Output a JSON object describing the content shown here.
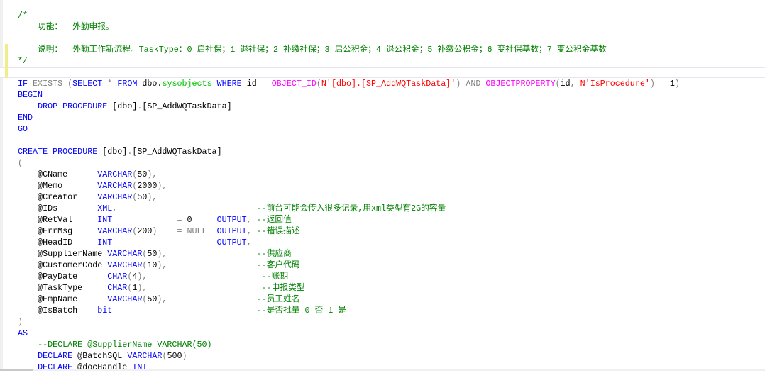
{
  "colors": {
    "keyword": "#0000ff",
    "comment": "#008000",
    "string": "#ff0000",
    "function": "#ff00ff",
    "operator": "#808080",
    "system": "#00c000"
  },
  "code": {
    "lines": [
      {
        "tokens": [
          [
            "cmt",
            "/*"
          ]
        ]
      },
      {
        "tokens": [
          [
            "cmt",
            "    功能：  外勤申报。"
          ]
        ]
      },
      {
        "tokens": []
      },
      {
        "mark": true,
        "tokens": [
          [
            "cmt",
            "    说明：  外勤工作新流程。TaskType：0=启社保；1=退社保；2=补缴社保；3=启公积金；4=退公积金；5=补缴公积金；6=变社保基数；7=变公积金基数"
          ]
        ]
      },
      {
        "mark": true,
        "tokens": [
          [
            "cmt",
            "*/"
          ]
        ]
      },
      {
        "mark": true,
        "cursor": true,
        "tokens": []
      },
      {
        "tokens": [
          [
            "kw",
            "IF"
          ],
          [
            "pl",
            " "
          ],
          [
            "gray",
            "EXISTS"
          ],
          [
            "pl",
            " "
          ],
          [
            "gray",
            "("
          ],
          [
            "kw",
            "SELECT"
          ],
          [
            "pl",
            " "
          ],
          [
            "gray",
            "*"
          ],
          [
            "pl",
            " "
          ],
          [
            "kw",
            "FROM"
          ],
          [
            "pl",
            " dbo."
          ],
          [
            "sys",
            "sysobjects"
          ],
          [
            "pl",
            " "
          ],
          [
            "kw",
            "WHERE"
          ],
          [
            "pl",
            " id "
          ],
          [
            "gray",
            "="
          ],
          [
            "pl",
            " "
          ],
          [
            "fn",
            "OBJECT_ID"
          ],
          [
            "gray",
            "("
          ],
          [
            "str",
            "N'[dbo].[SP_AddWQTaskData]'"
          ],
          [
            "gray",
            ")"
          ],
          [
            "pl",
            " "
          ],
          [
            "gray",
            "AND"
          ],
          [
            "pl",
            " "
          ],
          [
            "fn",
            "OBJECTPROPERTY"
          ],
          [
            "gray",
            "("
          ],
          [
            "pl",
            "id"
          ],
          [
            "gray",
            ","
          ],
          [
            "pl",
            " "
          ],
          [
            "str",
            "N'IsProcedure'"
          ],
          [
            "gray",
            ")"
          ],
          [
            "pl",
            " "
          ],
          [
            "gray",
            "="
          ],
          [
            "pl",
            " 1"
          ],
          [
            "gray",
            ")"
          ]
        ]
      },
      {
        "tokens": [
          [
            "kw",
            "BEGIN"
          ]
        ]
      },
      {
        "tokens": [
          [
            "pl",
            "    "
          ],
          [
            "kw",
            "DROP"
          ],
          [
            "pl",
            " "
          ],
          [
            "kw",
            "PROCEDURE"
          ],
          [
            "pl",
            " [dbo]"
          ],
          [
            "gray",
            "."
          ],
          [
            "pl",
            "[SP_AddWQTaskData]"
          ]
        ]
      },
      {
        "tokens": [
          [
            "kw",
            "END"
          ]
        ]
      },
      {
        "tokens": [
          [
            "kw",
            "GO"
          ]
        ]
      },
      {
        "tokens": []
      },
      {
        "tokens": [
          [
            "kw",
            "CREATE"
          ],
          [
            "pl",
            " "
          ],
          [
            "kw",
            "PROCEDURE"
          ],
          [
            "pl",
            " [dbo]"
          ],
          [
            "gray",
            "."
          ],
          [
            "pl",
            "[SP_AddWQTaskData]"
          ]
        ]
      },
      {
        "tokens": [
          [
            "gray",
            "("
          ]
        ]
      },
      {
        "tokens": [
          [
            "pl",
            "    @CName      "
          ],
          [
            "kw",
            "VARCHAR"
          ],
          [
            "gray",
            "("
          ],
          [
            "pl",
            "50"
          ],
          [
            "gray",
            "),"
          ]
        ]
      },
      {
        "tokens": [
          [
            "pl",
            "    @Memo       "
          ],
          [
            "kw",
            "VARCHAR"
          ],
          [
            "gray",
            "("
          ],
          [
            "pl",
            "2000"
          ],
          [
            "gray",
            "),"
          ]
        ]
      },
      {
        "tokens": [
          [
            "pl",
            "    @Creator    "
          ],
          [
            "kw",
            "VARCHAR"
          ],
          [
            "gray",
            "("
          ],
          [
            "pl",
            "50"
          ],
          [
            "gray",
            "),"
          ]
        ]
      },
      {
        "tokens": [
          [
            "pl",
            "    @IDs        "
          ],
          [
            "kw",
            "XML"
          ],
          [
            "gray",
            ","
          ],
          [
            "pl",
            "                            "
          ],
          [
            "cmt",
            "--前台可能会传入很多记录,用xml类型有2G的容量"
          ]
        ]
      },
      {
        "tokens": [
          [
            "pl",
            "    @RetVal     "
          ],
          [
            "kw",
            "INT"
          ],
          [
            "pl",
            "             "
          ],
          [
            "gray",
            "="
          ],
          [
            "pl",
            " 0     "
          ],
          [
            "kw",
            "OUTPUT"
          ],
          [
            "gray",
            ","
          ],
          [
            "pl",
            " "
          ],
          [
            "cmt",
            "--返回值"
          ]
        ]
      },
      {
        "tokens": [
          [
            "pl",
            "    @ErrMsg     "
          ],
          [
            "kw",
            "VARCHAR"
          ],
          [
            "gray",
            "("
          ],
          [
            "pl",
            "200"
          ],
          [
            "gray",
            ")"
          ],
          [
            "pl",
            "    "
          ],
          [
            "gray",
            "= NULL"
          ],
          [
            "pl",
            "  "
          ],
          [
            "kw",
            "OUTPUT"
          ],
          [
            "gray",
            ","
          ],
          [
            "pl",
            " "
          ],
          [
            "cmt",
            "--错误描述"
          ]
        ]
      },
      {
        "tokens": [
          [
            "pl",
            "    @HeadID     "
          ],
          [
            "kw",
            "INT"
          ],
          [
            "pl",
            "                     "
          ],
          [
            "kw",
            "OUTPUT"
          ],
          [
            "gray",
            ","
          ]
        ]
      },
      {
        "tokens": [
          [
            "pl",
            "    @SupplierName "
          ],
          [
            "kw",
            "VARCHAR"
          ],
          [
            "gray",
            "("
          ],
          [
            "pl",
            "50"
          ],
          [
            "gray",
            "),"
          ],
          [
            "pl",
            "                  "
          ],
          [
            "cmt",
            "--供应商"
          ]
        ]
      },
      {
        "tokens": [
          [
            "pl",
            "    @CustomerCode "
          ],
          [
            "kw",
            "VARCHAR"
          ],
          [
            "gray",
            "("
          ],
          [
            "pl",
            "10"
          ],
          [
            "gray",
            "),"
          ],
          [
            "pl",
            "                  "
          ],
          [
            "cmt",
            "--客户代码"
          ]
        ]
      },
      {
        "tokens": [
          [
            "pl",
            "    @PayDate      "
          ],
          [
            "kw",
            "CHAR"
          ],
          [
            "gray",
            "("
          ],
          [
            "pl",
            "4"
          ],
          [
            "gray",
            "),"
          ],
          [
            "pl",
            "                       "
          ],
          [
            "cmt",
            "--账期"
          ]
        ]
      },
      {
        "tokens": [
          [
            "pl",
            "    @TaskType     "
          ],
          [
            "kw",
            "CHAR"
          ],
          [
            "gray",
            "("
          ],
          [
            "pl",
            "1"
          ],
          [
            "gray",
            "),"
          ],
          [
            "pl",
            "                       "
          ],
          [
            "cmt",
            "--申报类型"
          ]
        ]
      },
      {
        "tokens": [
          [
            "pl",
            "    @EmpName      "
          ],
          [
            "kw",
            "VARCHAR"
          ],
          [
            "gray",
            "("
          ],
          [
            "pl",
            "50"
          ],
          [
            "gray",
            "),"
          ],
          [
            "pl",
            "                  "
          ],
          [
            "cmt",
            "--员工姓名"
          ]
        ]
      },
      {
        "tokens": [
          [
            "pl",
            "    @IsBatch    "
          ],
          [
            "kw",
            "bit"
          ],
          [
            "pl",
            "                             "
          ],
          [
            "cmt",
            "--是否批量 0 否 1 是"
          ]
        ]
      },
      {
        "tokens": [
          [
            "gray",
            ")"
          ]
        ]
      },
      {
        "tokens": [
          [
            "kw",
            "AS"
          ]
        ]
      },
      {
        "tokens": [
          [
            "pl",
            "    "
          ],
          [
            "cmt",
            "--DECLARE @SupplierName VARCHAR(50)"
          ]
        ]
      },
      {
        "tokens": [
          [
            "pl",
            "    "
          ],
          [
            "kw",
            "DECLARE"
          ],
          [
            "pl",
            " @BatchSQL "
          ],
          [
            "kw",
            "VARCHAR"
          ],
          [
            "gray",
            "("
          ],
          [
            "pl",
            "500"
          ],
          [
            "gray",
            ")"
          ]
        ]
      },
      {
        "tokens": [
          [
            "pl",
            "    "
          ],
          [
            "kw",
            "DECLARE"
          ],
          [
            "pl",
            " @docHandle "
          ],
          [
            "kw",
            "INT"
          ]
        ]
      }
    ]
  }
}
